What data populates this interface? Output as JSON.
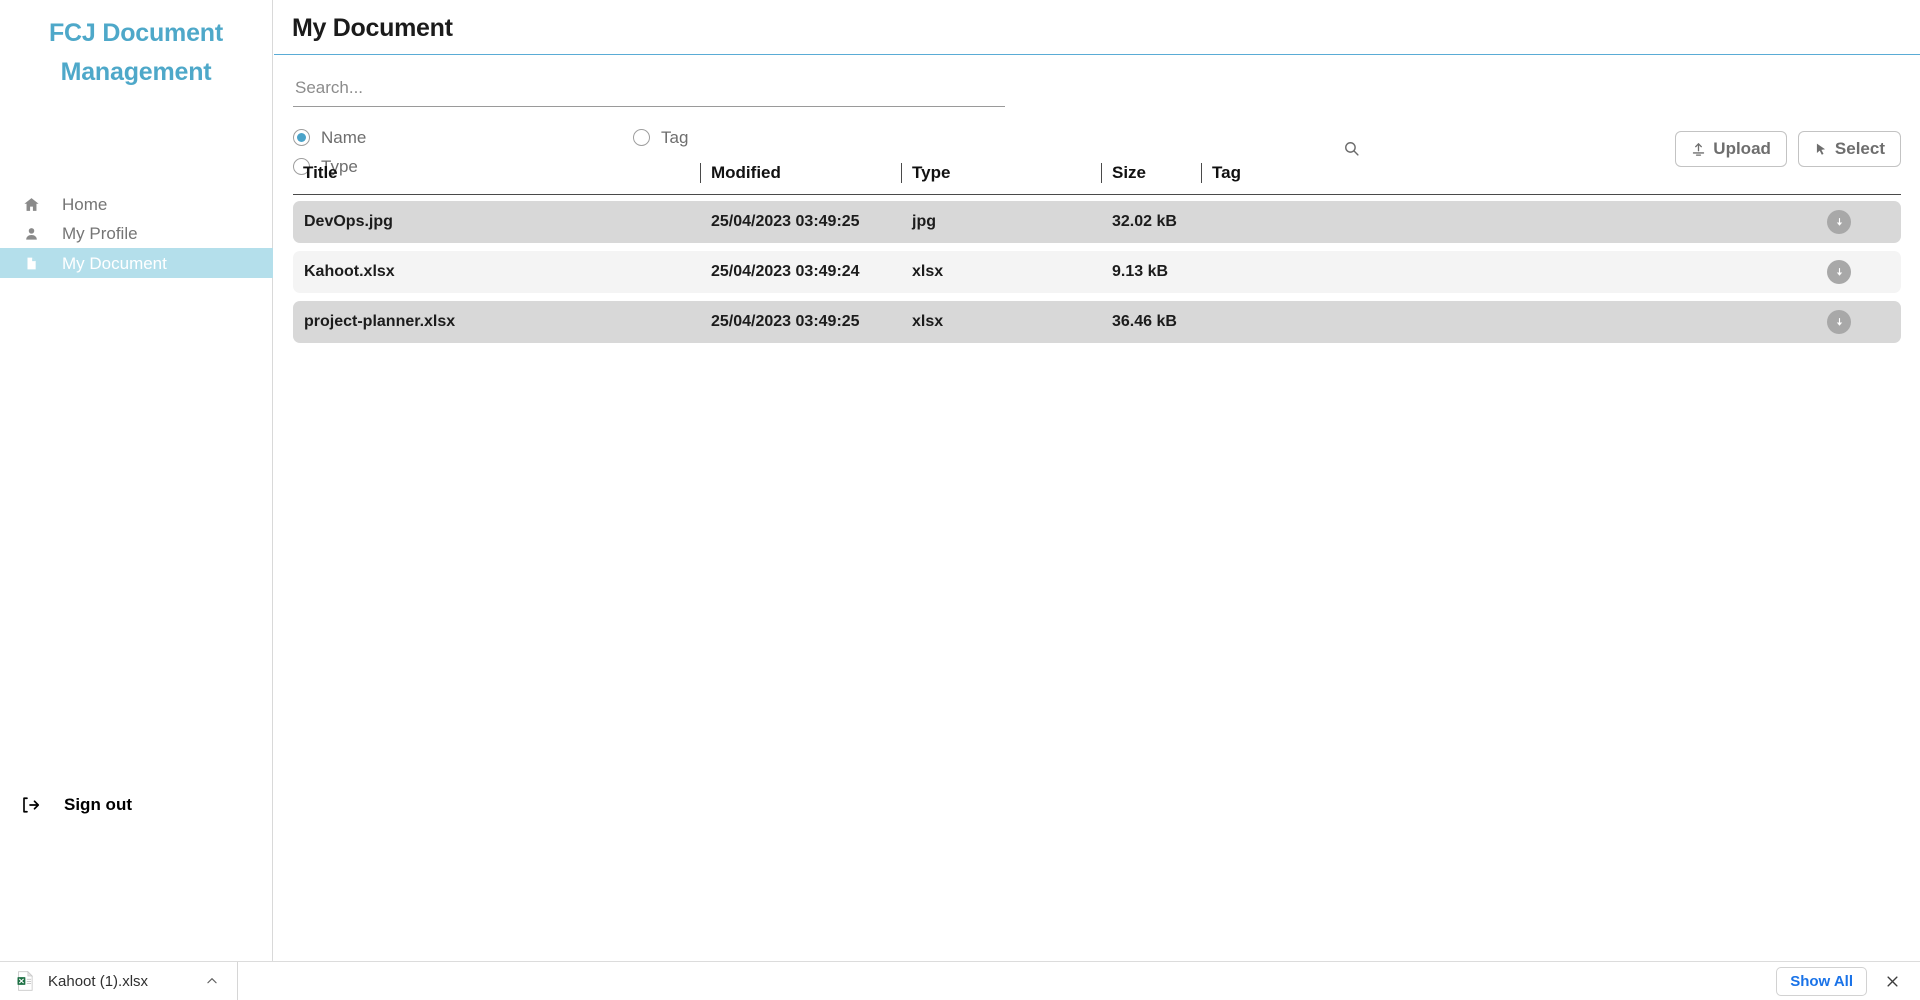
{
  "brand": {
    "line1": "FCJ Document",
    "line2": "Management",
    "color": "#4ea8c9"
  },
  "sidebar": {
    "items": [
      {
        "label": "Home",
        "icon": "home-icon",
        "active": false
      },
      {
        "label": "My Profile",
        "icon": "person-icon",
        "active": false
      },
      {
        "label": "My Document",
        "icon": "document-icon",
        "active": true
      }
    ],
    "signout": {
      "label": "Sign out",
      "icon": "logout-icon"
    },
    "active_bg": "#b4dfeb"
  },
  "header": {
    "title": "My Document",
    "underline_color": "#5aacd6"
  },
  "search": {
    "value": "",
    "placeholder": "Search...",
    "icon": "search-icon"
  },
  "filters": {
    "selected": "Name",
    "options": [
      {
        "label": "Name",
        "checked": true
      },
      {
        "label": "Tag",
        "checked": false
      },
      {
        "label": "Type",
        "checked": false
      }
    ],
    "accent": "#4ba3c9"
  },
  "toolbar": {
    "upload_label": "Upload",
    "upload_icon": "upload-icon",
    "select_label": "Select",
    "select_icon": "cursor-arrow-icon"
  },
  "table": {
    "columns": [
      "Title",
      "Modified",
      "Type",
      "Size",
      "Tag"
    ],
    "rows": [
      {
        "title": "DevOps.jpg",
        "modified": "25/04/2023 03:49:25",
        "type": "jpg",
        "size": "32.02 kB",
        "tag": "",
        "download_icon": "download-icon"
      },
      {
        "title": "Kahoot.xlsx",
        "modified": "25/04/2023 03:49:24",
        "type": "xlsx",
        "size": "9.13 kB",
        "tag": "",
        "download_icon": "download-icon"
      },
      {
        "title": "project-planner.xlsx",
        "modified": "25/04/2023 03:49:25",
        "type": "xlsx",
        "size": "36.46 kB",
        "tag": "",
        "download_icon": "download-icon"
      }
    ]
  },
  "download_shelf": {
    "file_name": "Kahoot (1).xlsx",
    "file_icon": "excel-file-icon",
    "expand_icon": "chevron-up-icon",
    "show_all_label": "Show All",
    "show_all_color": "#1a73e8",
    "close_icon": "close-icon"
  }
}
